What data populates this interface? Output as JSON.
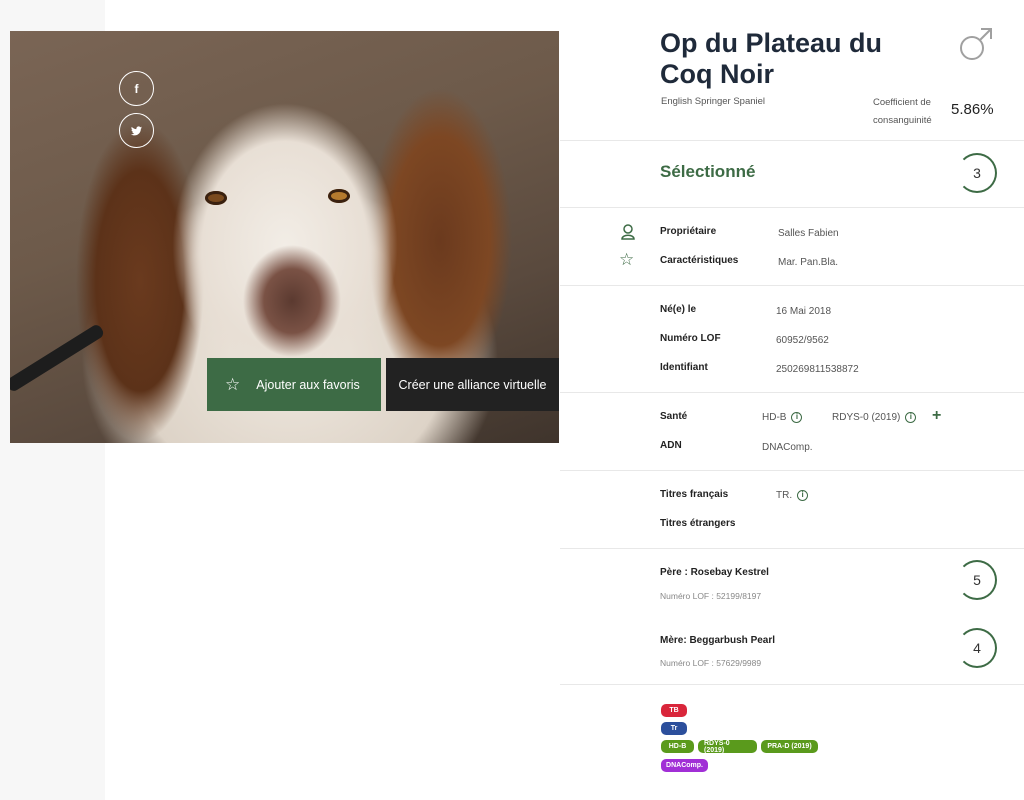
{
  "photo": {
    "social_fb": "f",
    "social_tw": "t",
    "fav_label": "Ajouter aux favoris",
    "alliance_label": "Créer une alliance virtuelle"
  },
  "header": {
    "name": "Op du Plateau du Coq Noir",
    "breed": "English Springer Spaniel",
    "coeff_label": "Coefficient de consanguinité",
    "coeff_value": "5.86%",
    "gender_icon": "male-icon"
  },
  "selection": {
    "label": "Sélectionné",
    "level": "3"
  },
  "owner": {
    "owner_label": "Propriétaire",
    "owner_value": "Salles Fabien",
    "traits_label": "Caractéristiques",
    "traits_value": "Mar. Pan.Bla."
  },
  "identity": {
    "born_label": "Né(e) le",
    "born_value": "16 Mai 2018",
    "lof_label": "Numéro LOF",
    "lof_value": "60952/9562",
    "id_label": "Identifiant",
    "id_value": "250269811538872"
  },
  "health": {
    "health_label": "Santé",
    "health_hd": "HD-B",
    "health_rdys": "RDYS-0 (2019)",
    "dna_label": "ADN",
    "dna_value": "DNAComp."
  },
  "titles": {
    "fr_label": "Titres français",
    "fr_value": "TR.",
    "foreign_label": "Titres étrangers"
  },
  "parents": {
    "father_name": "Père : Rosebay Kestrel",
    "father_lof": "Numéro LOF : 52199/8197",
    "father_level": "5",
    "mother_name": "Mère: Beggarbush Pearl",
    "mother_lof": "Numéro LOF : 57629/9989",
    "mother_level": "4"
  },
  "badges": {
    "tb": "TB",
    "tr": "Tr",
    "hd": "HD-B",
    "rdys": "RDYS-0 (2019)",
    "pra": "PRA-D (2019)",
    "dna": "DNAComp.",
    "colors": {
      "red": "#d9263b",
      "blue": "#2c4f9c",
      "green": "#5a9a1c",
      "purple": "#a12fd6"
    }
  },
  "colors": {
    "accent": "#3d6b45",
    "dark": "#222222",
    "title": "#1f2a3a"
  }
}
